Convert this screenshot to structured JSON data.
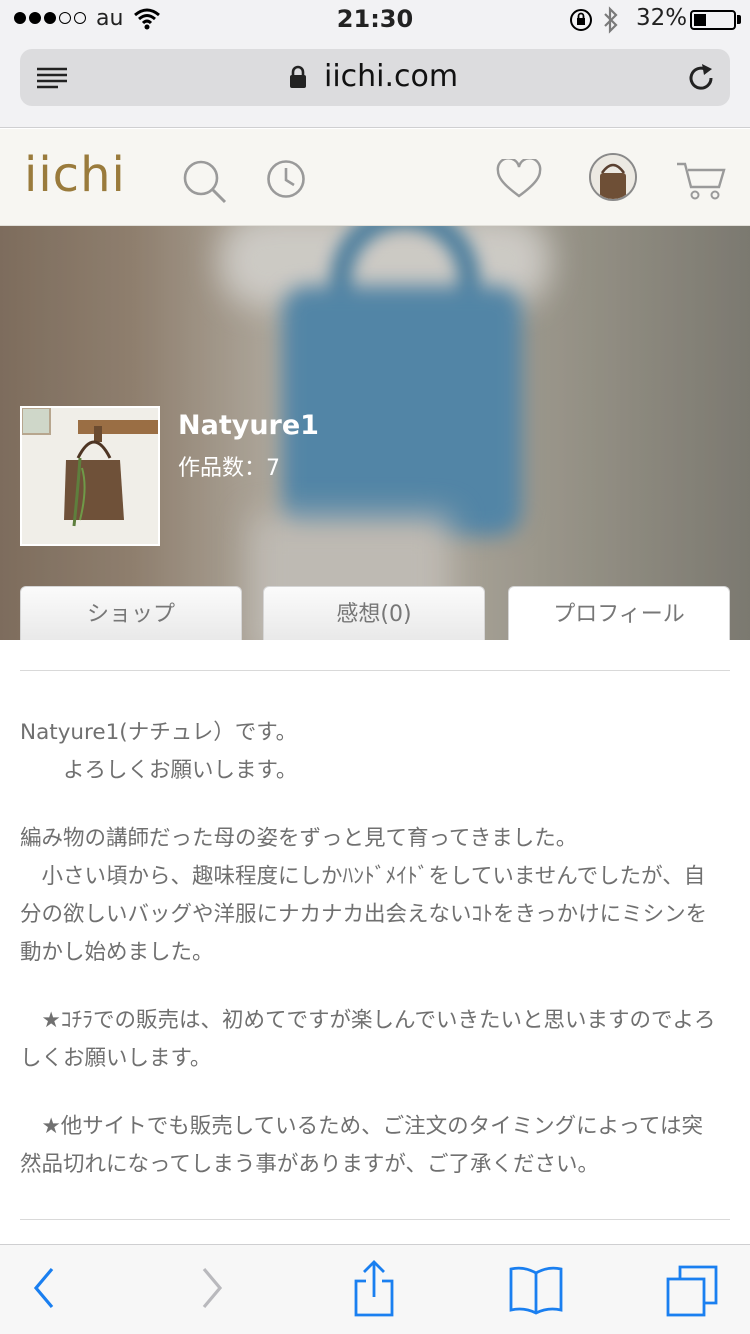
{
  "status_bar": {
    "carrier": "au",
    "time": "21:30",
    "battery_percent": "32%",
    "battery_level": 0.32,
    "signal_bars": 3
  },
  "browser": {
    "url": "iichi.com"
  },
  "site_header": {
    "logo": "iichi",
    "brand_color": "#9a7b3c"
  },
  "shop": {
    "name": "Natyure1",
    "item_count": "作品数：7"
  },
  "tabs": [
    {
      "label": "ショップ",
      "active": false
    },
    {
      "label": "感想(0)",
      "active": false
    },
    {
      "label": "プロフィール",
      "active": true
    }
  ],
  "profile": {
    "paragraphs": [
      "Natyure1(ナチュレ）です。\n　　よろしくお願いします。",
      "編み物の講師だった母の姿をずっと見て育ってきました。\n　小さい頃から、趣味程度にしかﾊﾝﾄﾞﾒｲﾄﾞをしていませんでしたが、自分の欲しいバッグや洋服にナカナカ出会えないｺﾄをきっかけにミシンを動かし始めました。",
      "　★ｺﾁﾗでの販売は、初めてですが楽しんでいきたいと思いますのでよろしくお願いします。",
      "　★他サイトでも販売しているため、ご注文のタイミングによっては突然品切れになってしまう事がありますが、ご了承ください。"
    ]
  },
  "toolbar": {
    "accent_color": "#1a7ff0"
  }
}
